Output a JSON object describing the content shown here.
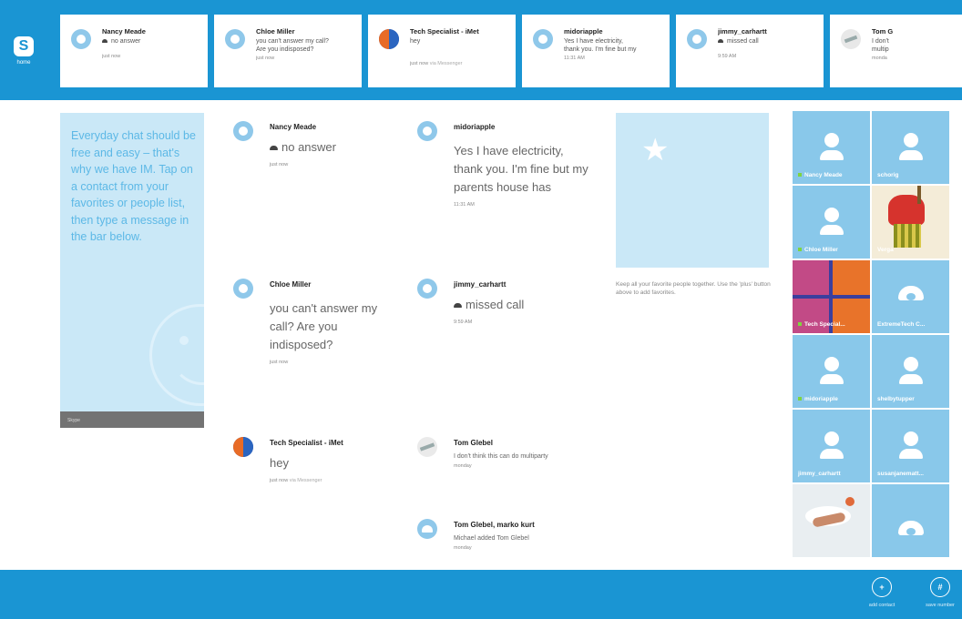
{
  "app": {
    "home_label": "home",
    "logo_letter": "S"
  },
  "recent_tiles": [
    {
      "name": "Nancy Meade",
      "line1": "no answer",
      "line2": "",
      "line3": "",
      "time": "just now",
      "sub": ""
    },
    {
      "name": "Chloe Miller",
      "line1": "you can't answer my call?",
      "line2": "Are you indisposed?",
      "line3": "",
      "time": "just now",
      "sub": ""
    },
    {
      "name": "Tech Specialist - iMet",
      "line1": "hey",
      "line2": "",
      "line3": "",
      "time": "just now",
      "sub": "via Messenger"
    },
    {
      "name": "midoriapple",
      "line1": "Yes I have electricity,",
      "line2": "thank you. I'm fine but my",
      "line3": "",
      "time": "11:31 AM",
      "sub": ""
    },
    {
      "name": "jimmy_carhartt",
      "line1": "missed call",
      "line2": "",
      "line3": "",
      "time": "9:59 AM",
      "sub": ""
    },
    {
      "name": "Tom G",
      "line1": "I don't",
      "line2": "multip",
      "line3": "",
      "time": "monda",
      "sub": ""
    }
  ],
  "tip": {
    "text": "Everyday chat should be free and easy – that's why we have IM. Tap on a contact from your favorites or people list, then type a message in the bar below.",
    "footer": "Skype"
  },
  "conversations": [
    {
      "name": "Nancy Meade",
      "message": "no answer",
      "time": "just now",
      "sub": ""
    },
    {
      "name": "Chloe Miller",
      "message": "you can't answer my call? Are you indisposed?",
      "time": "just now",
      "sub": ""
    },
    {
      "name": "Tech Specialist - iMet",
      "message": "hey",
      "time": "just now",
      "sub": "via Messenger"
    },
    {
      "name": "midoriapple",
      "message": "Yes I have electricity, thank you. I'm fine but my parents house has",
      "time": "11:31 AM",
      "sub": ""
    },
    {
      "name": "jimmy_carhartt",
      "message": "missed call",
      "time": "9:59 AM",
      "sub": ""
    },
    {
      "name": "Tom Glebel",
      "message": "I don't think this can do multiparty",
      "time": "monday",
      "sub": ""
    },
    {
      "name": "Tom Glebel, marko kurt",
      "message": "Michael added Tom Glebel",
      "time": "monday",
      "sub": ""
    }
  ],
  "favorites": {
    "note": "Keep all your favorite people together. Use the 'plus' button above to add favorites."
  },
  "people": [
    {
      "name": "Nancy Meade",
      "online": true
    },
    {
      "name": "schorig",
      "online": false
    },
    {
      "name": "Chloe Miller",
      "online": true
    },
    {
      "name": "Verga",
      "online": false
    },
    {
      "name": "Tech Special...",
      "online": true
    },
    {
      "name": "ExtremeTech C...",
      "online": false
    },
    {
      "name": "midoriapple",
      "online": true
    },
    {
      "name": "shelbytupper",
      "online": false
    },
    {
      "name": "jimmy_carhartt",
      "online": false
    },
    {
      "name": "susanjanematt...",
      "online": false
    },
    {
      "name": "",
      "online": false
    },
    {
      "name": "",
      "online": false
    }
  ],
  "bottom_bar": {
    "add_contact": "add contact",
    "save_number": "save number"
  },
  "colors": {
    "accent": "#1a95d3",
    "tile_bg": "#89c8ea",
    "tip_bg": "#cae8f7",
    "online": "#7fd43f"
  }
}
